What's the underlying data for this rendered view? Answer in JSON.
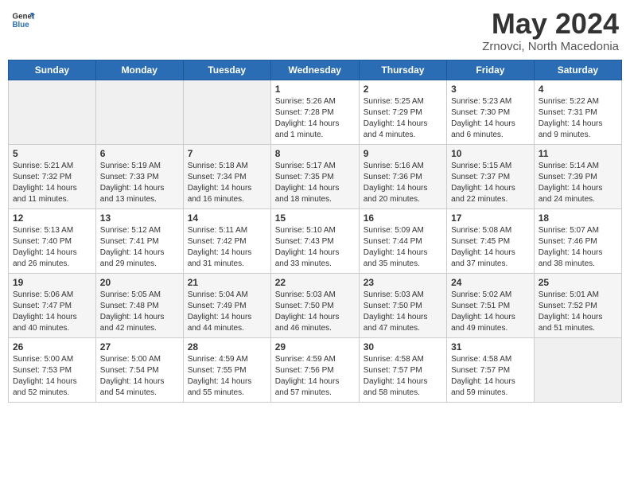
{
  "logo": {
    "text_general": "General",
    "text_blue": "Blue"
  },
  "title": "May 2024",
  "subtitle": "Zrnovci, North Macedonia",
  "days_of_week": [
    "Sunday",
    "Monday",
    "Tuesday",
    "Wednesday",
    "Thursday",
    "Friday",
    "Saturday"
  ],
  "weeks": [
    [
      {
        "day": "",
        "sunrise": "",
        "sunset": "",
        "daylight": ""
      },
      {
        "day": "",
        "sunrise": "",
        "sunset": "",
        "daylight": ""
      },
      {
        "day": "",
        "sunrise": "",
        "sunset": "",
        "daylight": ""
      },
      {
        "day": "1",
        "sunrise": "Sunrise: 5:26 AM",
        "sunset": "Sunset: 7:28 PM",
        "daylight": "Daylight: 14 hours and 1 minute."
      },
      {
        "day": "2",
        "sunrise": "Sunrise: 5:25 AM",
        "sunset": "Sunset: 7:29 PM",
        "daylight": "Daylight: 14 hours and 4 minutes."
      },
      {
        "day": "3",
        "sunrise": "Sunrise: 5:23 AM",
        "sunset": "Sunset: 7:30 PM",
        "daylight": "Daylight: 14 hours and 6 minutes."
      },
      {
        "day": "4",
        "sunrise": "Sunrise: 5:22 AM",
        "sunset": "Sunset: 7:31 PM",
        "daylight": "Daylight: 14 hours and 9 minutes."
      }
    ],
    [
      {
        "day": "5",
        "sunrise": "Sunrise: 5:21 AM",
        "sunset": "Sunset: 7:32 PM",
        "daylight": "Daylight: 14 hours and 11 minutes."
      },
      {
        "day": "6",
        "sunrise": "Sunrise: 5:19 AM",
        "sunset": "Sunset: 7:33 PM",
        "daylight": "Daylight: 14 hours and 13 minutes."
      },
      {
        "day": "7",
        "sunrise": "Sunrise: 5:18 AM",
        "sunset": "Sunset: 7:34 PM",
        "daylight": "Daylight: 14 hours and 16 minutes."
      },
      {
        "day": "8",
        "sunrise": "Sunrise: 5:17 AM",
        "sunset": "Sunset: 7:35 PM",
        "daylight": "Daylight: 14 hours and 18 minutes."
      },
      {
        "day": "9",
        "sunrise": "Sunrise: 5:16 AM",
        "sunset": "Sunset: 7:36 PM",
        "daylight": "Daylight: 14 hours and 20 minutes."
      },
      {
        "day": "10",
        "sunrise": "Sunrise: 5:15 AM",
        "sunset": "Sunset: 7:37 PM",
        "daylight": "Daylight: 14 hours and 22 minutes."
      },
      {
        "day": "11",
        "sunrise": "Sunrise: 5:14 AM",
        "sunset": "Sunset: 7:39 PM",
        "daylight": "Daylight: 14 hours and 24 minutes."
      }
    ],
    [
      {
        "day": "12",
        "sunrise": "Sunrise: 5:13 AM",
        "sunset": "Sunset: 7:40 PM",
        "daylight": "Daylight: 14 hours and 26 minutes."
      },
      {
        "day": "13",
        "sunrise": "Sunrise: 5:12 AM",
        "sunset": "Sunset: 7:41 PM",
        "daylight": "Daylight: 14 hours and 29 minutes."
      },
      {
        "day": "14",
        "sunrise": "Sunrise: 5:11 AM",
        "sunset": "Sunset: 7:42 PM",
        "daylight": "Daylight: 14 hours and 31 minutes."
      },
      {
        "day": "15",
        "sunrise": "Sunrise: 5:10 AM",
        "sunset": "Sunset: 7:43 PM",
        "daylight": "Daylight: 14 hours and 33 minutes."
      },
      {
        "day": "16",
        "sunrise": "Sunrise: 5:09 AM",
        "sunset": "Sunset: 7:44 PM",
        "daylight": "Daylight: 14 hours and 35 minutes."
      },
      {
        "day": "17",
        "sunrise": "Sunrise: 5:08 AM",
        "sunset": "Sunset: 7:45 PM",
        "daylight": "Daylight: 14 hours and 37 minutes."
      },
      {
        "day": "18",
        "sunrise": "Sunrise: 5:07 AM",
        "sunset": "Sunset: 7:46 PM",
        "daylight": "Daylight: 14 hours and 38 minutes."
      }
    ],
    [
      {
        "day": "19",
        "sunrise": "Sunrise: 5:06 AM",
        "sunset": "Sunset: 7:47 PM",
        "daylight": "Daylight: 14 hours and 40 minutes."
      },
      {
        "day": "20",
        "sunrise": "Sunrise: 5:05 AM",
        "sunset": "Sunset: 7:48 PM",
        "daylight": "Daylight: 14 hours and 42 minutes."
      },
      {
        "day": "21",
        "sunrise": "Sunrise: 5:04 AM",
        "sunset": "Sunset: 7:49 PM",
        "daylight": "Daylight: 14 hours and 44 minutes."
      },
      {
        "day": "22",
        "sunrise": "Sunrise: 5:03 AM",
        "sunset": "Sunset: 7:50 PM",
        "daylight": "Daylight: 14 hours and 46 minutes."
      },
      {
        "day": "23",
        "sunrise": "Sunrise: 5:03 AM",
        "sunset": "Sunset: 7:50 PM",
        "daylight": "Daylight: 14 hours and 47 minutes."
      },
      {
        "day": "24",
        "sunrise": "Sunrise: 5:02 AM",
        "sunset": "Sunset: 7:51 PM",
        "daylight": "Daylight: 14 hours and 49 minutes."
      },
      {
        "day": "25",
        "sunrise": "Sunrise: 5:01 AM",
        "sunset": "Sunset: 7:52 PM",
        "daylight": "Daylight: 14 hours and 51 minutes."
      }
    ],
    [
      {
        "day": "26",
        "sunrise": "Sunrise: 5:00 AM",
        "sunset": "Sunset: 7:53 PM",
        "daylight": "Daylight: 14 hours and 52 minutes."
      },
      {
        "day": "27",
        "sunrise": "Sunrise: 5:00 AM",
        "sunset": "Sunset: 7:54 PM",
        "daylight": "Daylight: 14 hours and 54 minutes."
      },
      {
        "day": "28",
        "sunrise": "Sunrise: 4:59 AM",
        "sunset": "Sunset: 7:55 PM",
        "daylight": "Daylight: 14 hours and 55 minutes."
      },
      {
        "day": "29",
        "sunrise": "Sunrise: 4:59 AM",
        "sunset": "Sunset: 7:56 PM",
        "daylight": "Daylight: 14 hours and 57 minutes."
      },
      {
        "day": "30",
        "sunrise": "Sunrise: 4:58 AM",
        "sunset": "Sunset: 7:57 PM",
        "daylight": "Daylight: 14 hours and 58 minutes."
      },
      {
        "day": "31",
        "sunrise": "Sunrise: 4:58 AM",
        "sunset": "Sunset: 7:57 PM",
        "daylight": "Daylight: 14 hours and 59 minutes."
      },
      {
        "day": "",
        "sunrise": "",
        "sunset": "",
        "daylight": ""
      }
    ]
  ]
}
